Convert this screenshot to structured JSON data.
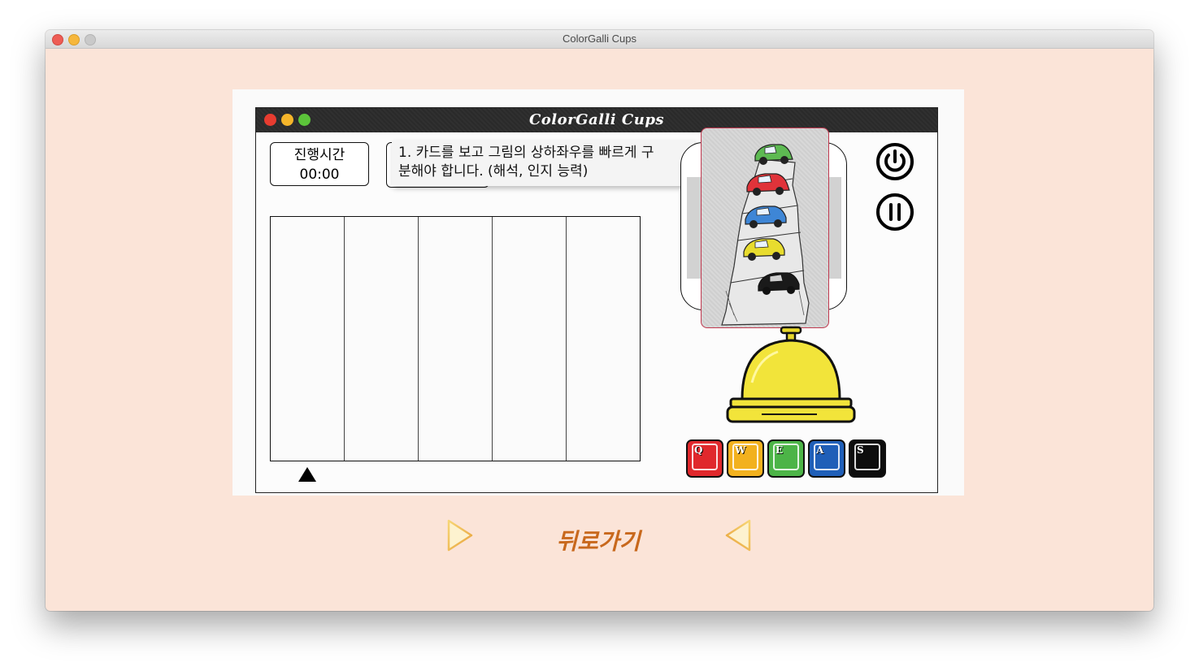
{
  "window": {
    "title": "ColorGalli Cups",
    "traffic_lights": [
      "#ee5c54",
      "#f6b73c",
      "#c9c9c9"
    ]
  },
  "inner_app": {
    "title": "ColorGalli Cups",
    "dots": [
      "#e83c30",
      "#f5b52a",
      "#5cc43a"
    ]
  },
  "timer": {
    "label": "진행시간",
    "value": "00:00"
  },
  "tooltip": {
    "line1": "1. 카드를 보고 그림의 상하좌우를 빠르게 구",
    "line2": "분해야 합니다. (해석, 인지 능력)"
  },
  "card": {
    "cars_top_to_bottom": [
      "green",
      "red",
      "blue",
      "yellow",
      "black"
    ]
  },
  "keys": [
    {
      "label": "Q",
      "color": "#e0282c"
    },
    {
      "label": "W",
      "color": "#f2b11e"
    },
    {
      "label": "E",
      "color": "#4cb447"
    },
    {
      "label": "A",
      "color": "#1f5fb8"
    },
    {
      "label": "S",
      "color": "#0d0d0d"
    }
  ],
  "nav": {
    "back_label": "뒤로가기",
    "arrow_color": "#f4c14a"
  },
  "controls": {
    "power_icon": "power-icon",
    "pause_icon": "pause-icon"
  }
}
